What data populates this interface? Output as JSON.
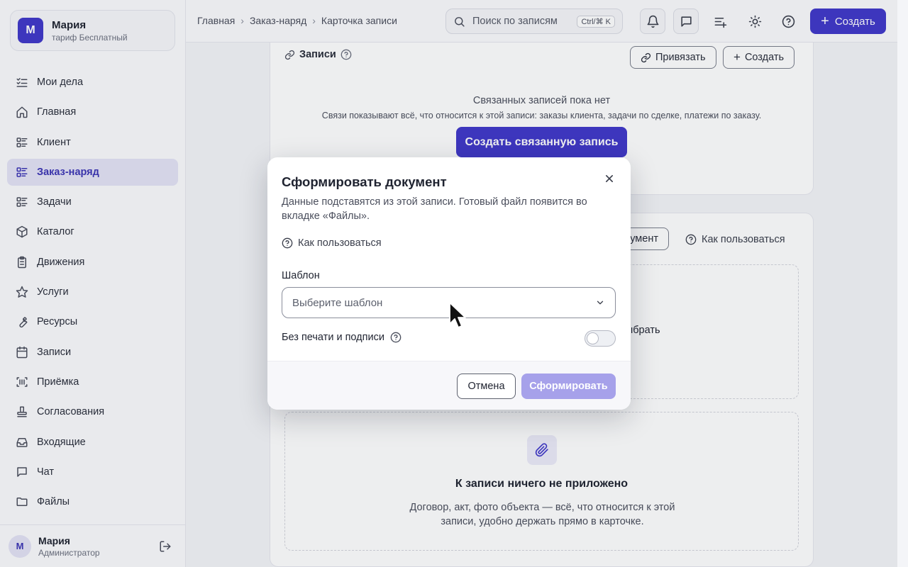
{
  "org": {
    "avatar_letter": "М",
    "name": "Мария",
    "plan": "тариф Бесплатный"
  },
  "sidebar": {
    "items": [
      {
        "label": "Мои дела",
        "icon": "checklist-icon",
        "active": false
      },
      {
        "label": "Главная",
        "icon": "home-icon",
        "active": false
      },
      {
        "label": "Клиент",
        "icon": "list-grid-icon",
        "active": false
      },
      {
        "label": "Заказ-наряд",
        "icon": "list-grid-icon",
        "active": true
      },
      {
        "label": "Задачи",
        "icon": "list-grid-icon",
        "active": false
      },
      {
        "label": "Каталог",
        "icon": "box-icon",
        "active": false
      },
      {
        "label": "Движения",
        "icon": "clipboard-icon",
        "active": false
      },
      {
        "label": "Услуги",
        "icon": "star-icon",
        "active": false
      },
      {
        "label": "Ресурсы",
        "icon": "wrench-icon",
        "active": false
      },
      {
        "label": "Записи",
        "icon": "calendar-icon",
        "active": false
      },
      {
        "label": "Приёмка",
        "icon": "barcode-icon",
        "active": false
      },
      {
        "label": "Согласования",
        "icon": "stamp-icon",
        "active": false
      },
      {
        "label": "Входящие",
        "icon": "inbox-icon",
        "active": false
      },
      {
        "label": "Чат",
        "icon": "chat-icon",
        "active": false
      },
      {
        "label": "Файлы",
        "icon": "folder-icon",
        "active": false
      }
    ]
  },
  "user": {
    "avatar_letter": "М",
    "name": "Мария",
    "role": "Администратор"
  },
  "topbar": {
    "breadcrumbs": [
      "Главная",
      "Заказ-наряд",
      "Карточка записи"
    ],
    "search_placeholder": "Поиск по записям",
    "search_shortcut": "Ctrl/⌘ K",
    "create_label": "Создать"
  },
  "links_section": {
    "title": "Записи",
    "link_button": "Привязать",
    "create_button": "Создать",
    "empty_title": "Связанных записей пока нет",
    "empty_subtitle": "Связи показывают всё, что относится к этой записи: заказы клиента, задачи по сделке, платежи по заказу.",
    "create_linked_button": "Создать связанную запись"
  },
  "docs_section": {
    "doc_button_partial": "умент",
    "help_label": "Как пользоваться",
    "drop_partial": "и выбрать",
    "drop_partial2": "у",
    "attach_title": "К записи ничего не приложено",
    "attach_desc": "Договор, акт, фото объекта — всё, что относится к этой записи, удобно держать прямо в карточке."
  },
  "modal": {
    "title": "Сформировать документ",
    "description": "Данные подставятся из этой записи. Готовый файл появится во вкладке «Файлы».",
    "help_label": "Как пользоваться",
    "template_label": "Шаблон",
    "template_placeholder": "Выберите шаблон",
    "toggle_label": "Без печати и подписи",
    "toggle_on": false,
    "cancel_label": "Отмена",
    "submit_label": "Сформировать"
  },
  "colors": {
    "accent": "#4138c9",
    "accent_disabled": "#a6a1ea",
    "active_nav_bg": "#e4e3f6"
  }
}
